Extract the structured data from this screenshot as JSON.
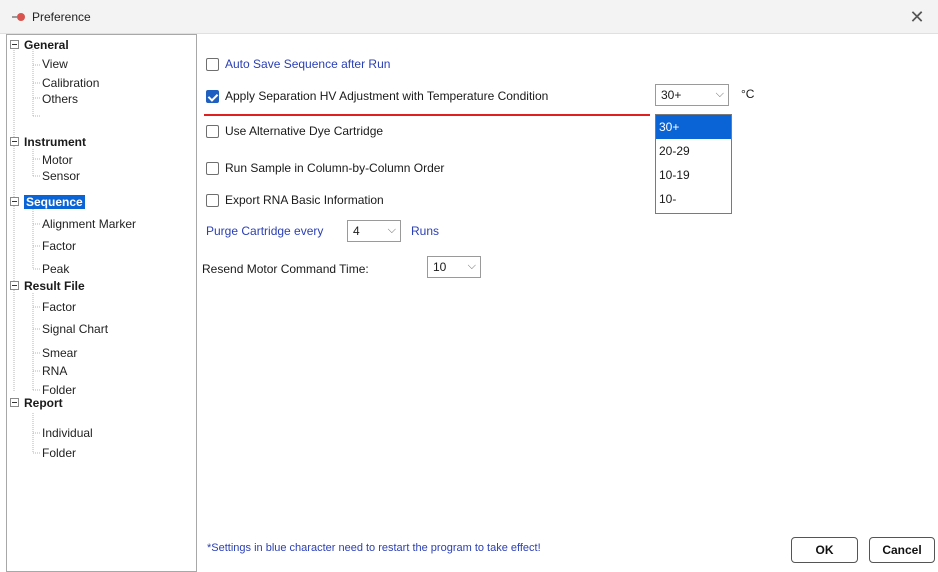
{
  "window": {
    "title": "Preference",
    "close_glyph": "✕"
  },
  "tree": {
    "groups": [
      {
        "label": "General",
        "children": [
          "View",
          "Calibration",
          "Others"
        ]
      },
      {
        "label": "Instrument",
        "children": [
          "Motor",
          "Sensor"
        ]
      },
      {
        "label": "Sequence",
        "children": [
          "Alignment Marker",
          "Factor",
          "Peak"
        ]
      },
      {
        "label": "Result File",
        "children": [
          "Factor",
          "Signal Chart",
          "Smear",
          "RNA",
          "Folder"
        ]
      },
      {
        "label": "Report",
        "children": [
          "Individual",
          "Folder"
        ]
      }
    ],
    "selected": "Sequence"
  },
  "settings": {
    "auto_save": {
      "label": "Auto Save Sequence after Run",
      "checked": false
    },
    "apply_hv": {
      "label": "Apply Separation HV Adjustment with Temperature Condition",
      "checked": true
    },
    "temp_select": {
      "value": "30+",
      "unit": "°C",
      "options": [
        "30+",
        "20-29",
        "10-19",
        "10-"
      ]
    },
    "alt_dye": {
      "label": "Use Alternative Dye Cartridge",
      "checked": false
    },
    "col_order": {
      "label": "Run Sample in Column-by-Column Order",
      "checked": false
    },
    "export_rna": {
      "label": "Export RNA Basic Information",
      "checked": false
    },
    "purge": {
      "prefix": "Purge Cartridge every",
      "value": "4",
      "suffix": "Runs"
    },
    "resend": {
      "label": "Resend Motor Command Time:",
      "value": "10"
    }
  },
  "footer": {
    "note": "*Settings in blue character need to restart the program to take effect!",
    "ok": "OK",
    "cancel": "Cancel"
  },
  "icons": {
    "chevron": "⌵",
    "app": "app-icon"
  },
  "colors": {
    "selection": "#0a64d6",
    "blue_text": "#2a3fb5",
    "underline": "#e02020"
  }
}
